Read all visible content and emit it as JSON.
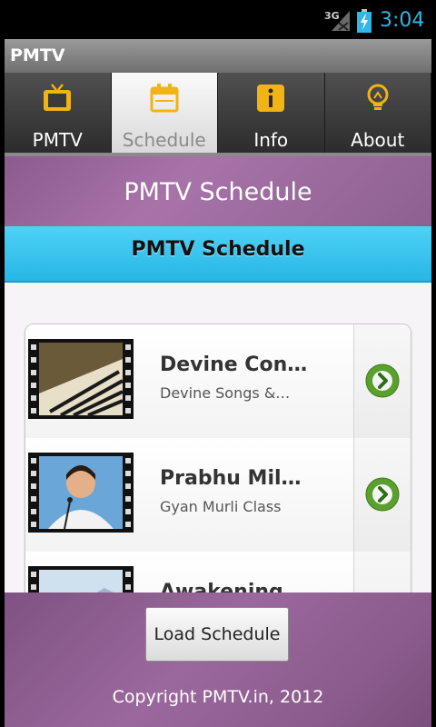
{
  "status_bar": {
    "network": "3G",
    "time": "3:04"
  },
  "app": {
    "title": "PMTV"
  },
  "tabs": [
    {
      "label": "PMTV",
      "icon": "tv-icon",
      "active": false
    },
    {
      "label": "Schedule",
      "icon": "calendar-icon",
      "active": true
    },
    {
      "label": "Info",
      "icon": "info-icon",
      "active": false
    },
    {
      "label": "About",
      "icon": "lightbulb-icon",
      "active": false
    }
  ],
  "page": {
    "header": "PMTV Schedule",
    "banner": "PMTV Schedule"
  },
  "list": [
    {
      "title": "Devine Con…",
      "subtitle": "Devine Songs &…"
    },
    {
      "title": "Prabhu Mil…",
      "subtitle": "Gyan Murli Class"
    },
    {
      "title": "Awakening",
      "subtitle": ""
    }
  ],
  "footer": {
    "button": "Load Schedule",
    "copyright": "Copyright PMTV.in, 2012"
  },
  "colors": {
    "accent": "#33b5e5",
    "purple": "#9a6a9c",
    "banner": "#27b6e6",
    "icon_gold": "#f2b315",
    "arrow_green": "#5aa02c"
  }
}
